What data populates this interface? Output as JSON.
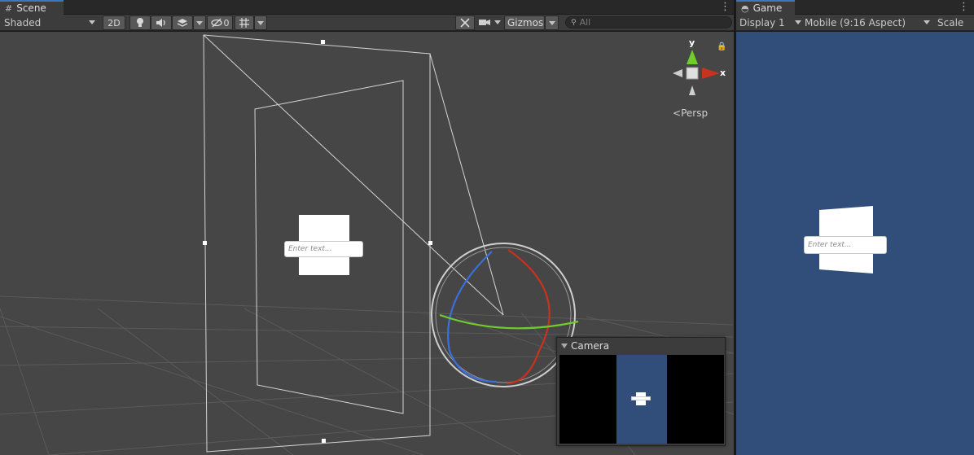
{
  "scene_panel": {
    "tab_label": "Scene",
    "shading_mode": "Shaded",
    "btn_2d": "2D",
    "hidden_count": "0",
    "gizmos_label": "Gizmos",
    "search_placeholder": "All",
    "view_mode": "Persp",
    "axis_y": "y",
    "axis_x": "x"
  },
  "game_panel": {
    "tab_label": "Game",
    "display": "Display 1",
    "aspect": "Mobile (9:16 Aspect)",
    "scale_label": "Scale"
  },
  "camera_preview": {
    "title": "Camera"
  },
  "ui_elements": {
    "input_placeholder": "Enter text..."
  },
  "colors": {
    "accent": "#3a79bb",
    "game_background": "#314d79",
    "scene_background": "#464646",
    "axis_x": "#c8321e",
    "axis_y": "#6fcd2c",
    "axis_z": "#3a6fe0"
  },
  "icons": {
    "scene_tab": "grid-icon",
    "game_tab": "gamepad-icon",
    "lighting": "lightbulb-icon",
    "audio": "speaker-icon",
    "effects": "layers-icon",
    "visibility": "eye-slash-icon",
    "grid": "grid-toggle-icon",
    "tools": "tools-icon",
    "camera": "camera-icon",
    "search": "search-icon",
    "lock": "lock-icon"
  }
}
